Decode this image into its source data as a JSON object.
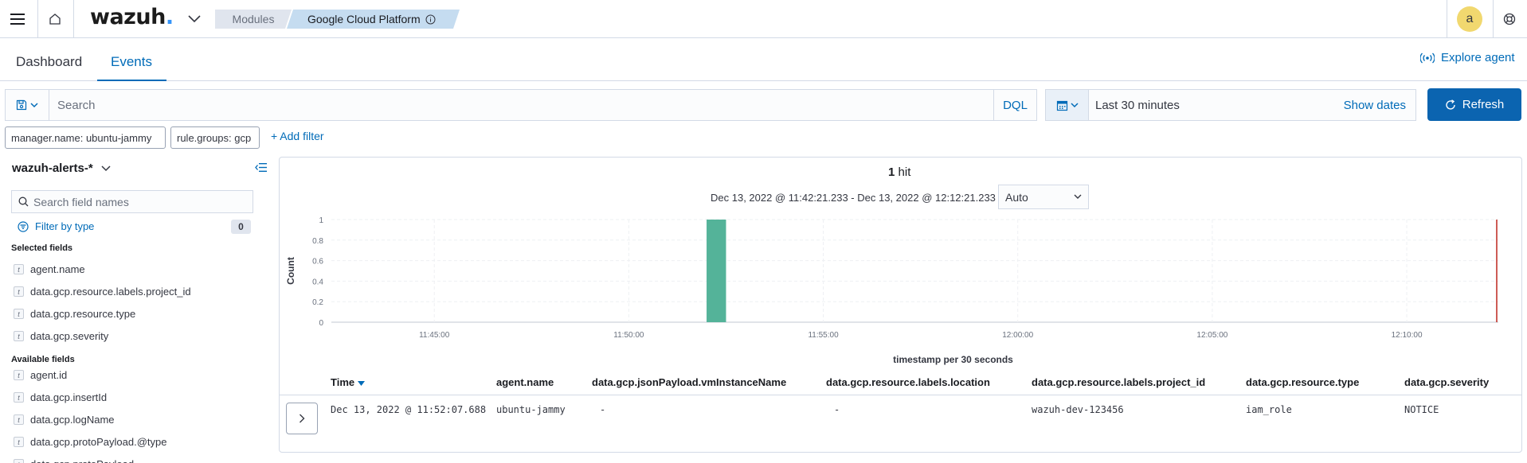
{
  "header": {
    "logo_text": "wazuh",
    "logo_dot": ".",
    "breadcrumbs": [
      "Modules",
      "Google Cloud Platform"
    ],
    "avatar_letter": "a"
  },
  "tabs": [
    {
      "label": "Dashboard",
      "active": false
    },
    {
      "label": "Events",
      "active": true
    }
  ],
  "explore_agent_label": "Explore agent",
  "search": {
    "placeholder": "Search",
    "value": "",
    "language_label": "DQL"
  },
  "date_picker": {
    "range": "Last 30 minutes",
    "show_dates_label": "Show dates"
  },
  "refresh_label": "Refresh",
  "filters": [
    "manager.name: ubuntu-jammy",
    "rule.groups: gcp"
  ],
  "add_filter_label": "+ Add filter",
  "sidebar": {
    "index_pattern": "wazuh-alerts-*",
    "field_search_placeholder": "Search field names",
    "filter_by_type_label": "Filter by type",
    "filter_count": "0",
    "selected_title": "Selected fields",
    "selected_fields": [
      "agent.name",
      "data.gcp.resource.labels.project_id",
      "data.gcp.resource.type",
      "data.gcp.severity"
    ],
    "available_title": "Available fields",
    "available_fields": [
      "agent.id",
      "data.gcp.insertId",
      "data.gcp.logName",
      "data.gcp.protoPayload.@type",
      "data.gcp.protoPayload"
    ],
    "type_token": "t"
  },
  "histogram_header": {
    "hits_count": "1",
    "hits_label": "hit",
    "time_range": "Dec 13, 2022 @ 11:42:21.233 - Dec 13, 2022 @ 12:12:21.233",
    "interval": "Auto"
  },
  "chart_data": {
    "type": "bar",
    "title": "",
    "xlabel": "timestamp per 30 seconds",
    "ylabel": "Count",
    "x_ticks": [
      "11:45:00",
      "11:50:00",
      "11:55:00",
      "12:00:00",
      "12:05:00",
      "12:10:00"
    ],
    "y_ticks": [
      "0",
      "0.2",
      "0.4",
      "0.6",
      "0.8",
      "1"
    ],
    "ylim": [
      0,
      1
    ],
    "series": [
      {
        "values": [
          {
            "x": "11:52:00",
            "y": 1
          }
        ]
      }
    ],
    "grid": true,
    "now_marker": "12:12:21.233",
    "colors": {
      "bar": "#54b399",
      "now_marker": "#bd271e"
    }
  },
  "table": {
    "columns": [
      "Time",
      "agent.name",
      "data.gcp.jsonPayload.vmInstanceName",
      "data.gcp.resource.labels.location",
      "data.gcp.resource.labels.project_id",
      "data.gcp.resource.type",
      "data.gcp.severity"
    ],
    "rows": [
      [
        "Dec 13, 2022 @ 11:52:07.688",
        "ubuntu-jammy",
        "-",
        "-",
        "wazuh-dev-123456",
        "iam_role",
        "NOTICE"
      ]
    ]
  },
  "colors": {
    "primary": "#006bb8",
    "button": "#0b64b0",
    "breadcrumb_active": "#c5dcf0",
    "avatar": "#f1d86f"
  }
}
